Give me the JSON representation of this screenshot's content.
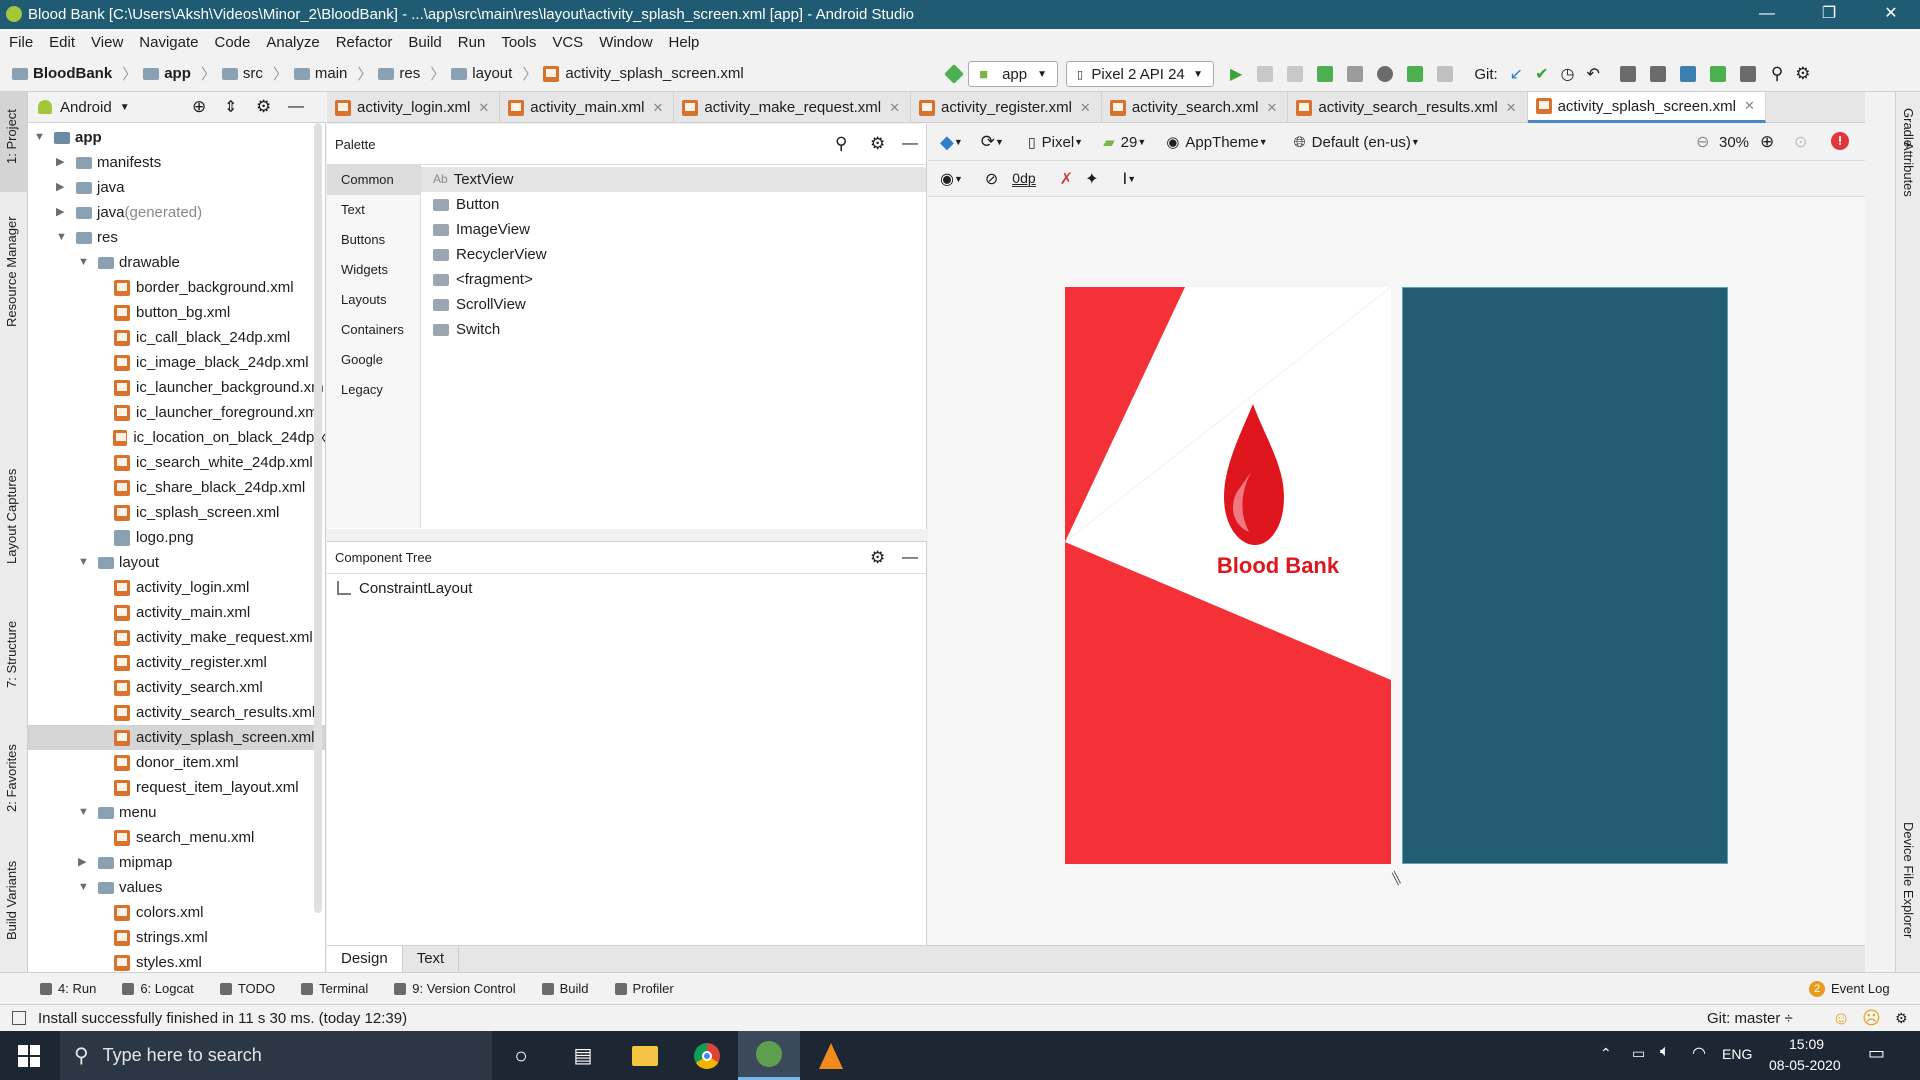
{
  "window": {
    "title": "Blood Bank [C:\\Users\\Aksh\\Videos\\Minor_2\\BloodBank] - ...\\app\\src\\main\\res\\layout\\activity_splash_screen.xml [app] - Android Studio",
    "minimize": "—",
    "restore": "❐",
    "close": "✕"
  },
  "menu": [
    "File",
    "Edit",
    "View",
    "Navigate",
    "Code",
    "Analyze",
    "Refactor",
    "Build",
    "Run",
    "Tools",
    "VCS",
    "Window",
    "Help"
  ],
  "breadcrumb": {
    "project": "BloodBank",
    "items": [
      "app",
      "src",
      "main",
      "res",
      "layout",
      "activity_splash_screen.xml"
    ]
  },
  "toolbar": {
    "run_config": "app",
    "device": "Pixel 2 API 24",
    "git_label": "Git:"
  },
  "side_left": {
    "project": "1: Project",
    "resource_manager": "Resource Manager",
    "layout_captures": "Layout Captures",
    "structure": "7: Structure",
    "favorites": "2: Favorites",
    "build_variants": "Build Variants"
  },
  "side_right": {
    "gradle": "Gradle",
    "attributes": "Attributes",
    "device_file_explorer": "Device File Explorer"
  },
  "project_panel": {
    "view_mode": "Android",
    "tree": [
      {
        "label": "app",
        "indent": 0,
        "arrow": "▼",
        "icon": "module",
        "bold": true
      },
      {
        "label": "manifests",
        "indent": 1,
        "arrow": "▶",
        "icon": "folder"
      },
      {
        "label": "java",
        "indent": 1,
        "arrow": "▶",
        "icon": "folder"
      },
      {
        "label": "java",
        "suffix": " (generated)",
        "indent": 1,
        "arrow": "▶",
        "icon": "folder"
      },
      {
        "label": "res",
        "indent": 1,
        "arrow": "▼",
        "icon": "folder"
      },
      {
        "label": "drawable",
        "indent": 2,
        "arrow": "▼",
        "icon": "folder"
      },
      {
        "label": "border_background.xml",
        "indent": 3,
        "icon": "xml"
      },
      {
        "label": "button_bg.xml",
        "indent": 3,
        "icon": "xml"
      },
      {
        "label": "ic_call_black_24dp.xml",
        "indent": 3,
        "icon": "xml"
      },
      {
        "label": "ic_image_black_24dp.xml",
        "indent": 3,
        "icon": "xml"
      },
      {
        "label": "ic_launcher_background.xm",
        "indent": 3,
        "icon": "xml"
      },
      {
        "label": "ic_launcher_foreground.xml",
        "indent": 3,
        "icon": "xml"
      },
      {
        "label": "ic_location_on_black_24dp.x",
        "indent": 3,
        "icon": "xml"
      },
      {
        "label": "ic_search_white_24dp.xml",
        "indent": 3,
        "icon": "xml"
      },
      {
        "label": "ic_share_black_24dp.xml",
        "indent": 3,
        "icon": "xml"
      },
      {
        "label": "ic_splash_screen.xml",
        "indent": 3,
        "icon": "xml"
      },
      {
        "label": "logo.png",
        "indent": 3,
        "icon": "png"
      },
      {
        "label": "layout",
        "indent": 2,
        "arrow": "▼",
        "icon": "folder"
      },
      {
        "label": "activity_login.xml",
        "indent": 3,
        "icon": "xml"
      },
      {
        "label": "activity_main.xml",
        "indent": 3,
        "icon": "xml"
      },
      {
        "label": "activity_make_request.xml",
        "indent": 3,
        "icon": "xml"
      },
      {
        "label": "activity_register.xml",
        "indent": 3,
        "icon": "xml"
      },
      {
        "label": "activity_search.xml",
        "indent": 3,
        "icon": "xml"
      },
      {
        "label": "activity_search_results.xml",
        "indent": 3,
        "icon": "xml"
      },
      {
        "label": "activity_splash_screen.xml",
        "indent": 3,
        "icon": "xml",
        "selected": true
      },
      {
        "label": "donor_item.xml",
        "indent": 3,
        "icon": "xml"
      },
      {
        "label": "request_item_layout.xml",
        "indent": 3,
        "icon": "xml"
      },
      {
        "label": "menu",
        "indent": 2,
        "arrow": "▼",
        "icon": "folder"
      },
      {
        "label": "search_menu.xml",
        "indent": 3,
        "icon": "xml"
      },
      {
        "label": "mipmap",
        "indent": 2,
        "arrow": "▶",
        "icon": "folder"
      },
      {
        "label": "values",
        "indent": 2,
        "arrow": "▼",
        "icon": "folder"
      },
      {
        "label": "colors.xml",
        "indent": 3,
        "icon": "xml"
      },
      {
        "label": "strings.xml",
        "indent": 3,
        "icon": "xml"
      },
      {
        "label": "styles.xml",
        "indent": 3,
        "icon": "xml"
      }
    ]
  },
  "editor_tabs": [
    {
      "label": "activity_login.xml"
    },
    {
      "label": "activity_main.xml"
    },
    {
      "label": "activity_make_request.xml"
    },
    {
      "label": "activity_register.xml"
    },
    {
      "label": "activity_search.xml"
    },
    {
      "label": "activity_search_results.xml"
    },
    {
      "label": "activity_splash_screen.xml",
      "active": true
    }
  ],
  "palette": {
    "title": "Palette",
    "categories": [
      "Common",
      "Text",
      "Buttons",
      "Widgets",
      "Layouts",
      "Containers",
      "Google",
      "Legacy"
    ],
    "selected_category": "Common",
    "items": [
      "TextView",
      "Button",
      "ImageView",
      "RecyclerView",
      "<fragment>",
      "ScrollView",
      "Switch"
    ],
    "textview_prefix": "Ab"
  },
  "component_tree": {
    "title": "Component Tree",
    "root": "ConstraintLayout"
  },
  "design_toolbar": {
    "device": "Pixel",
    "api": "29",
    "theme": "AppTheme",
    "locale": "Default (en-us)",
    "zoom": "30%",
    "margin": "0dp"
  },
  "preview": {
    "logo_text": "Blood Bank",
    "red": "#f33136",
    "blueprint": "#245c70",
    "drop_red": "#e0161e"
  },
  "bottom_tabs": [
    "Design",
    "Text"
  ],
  "tool_windows": [
    {
      "label": "4: Run",
      "icon": "run-icon"
    },
    {
      "label": "6: Logcat",
      "icon": "logcat-icon"
    },
    {
      "label": "TODO",
      "icon": "todo-icon"
    },
    {
      "label": "Terminal",
      "icon": "terminal-icon"
    },
    {
      "label": "9: Version Control",
      "icon": "vcs-icon"
    },
    {
      "label": "Build",
      "icon": "build-icon"
    },
    {
      "label": "Profiler",
      "icon": "profiler-icon"
    }
  ],
  "event_log": {
    "count": "2",
    "label": "Event Log"
  },
  "status": {
    "message": "Install successfully finished in 11 s 30 ms. (today 12:39)",
    "git": "Git: master ÷"
  },
  "taskbar": {
    "search_placeholder": "Type here to search",
    "lang": "ENG",
    "time": "15:09",
    "date": "08-05-2020"
  }
}
